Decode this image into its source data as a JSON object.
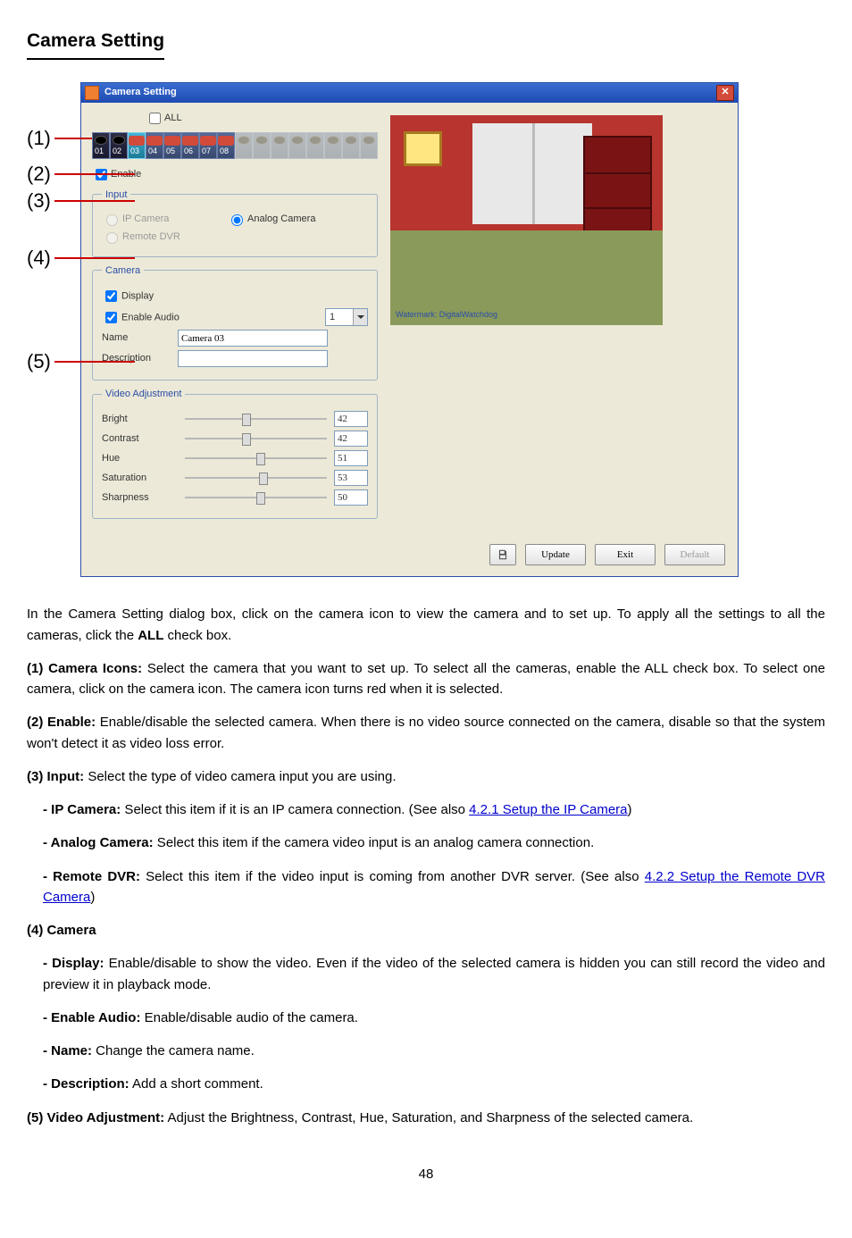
{
  "section_heading": "Camera Setting",
  "callouts": [
    "(1)",
    "(2)",
    "(3)",
    "(4)",
    "(5)"
  ],
  "window": {
    "title": "Camera Setting",
    "all_checkbox": "ALL",
    "tabs": [
      "01",
      "02",
      "03",
      "04",
      "05",
      "06",
      "07",
      "08"
    ],
    "enable": "Enable",
    "input_group": {
      "legend": "Input",
      "ip_camera": "IP Camera",
      "analog_camera": "Analog Camera",
      "remote_dvr": "Remote DVR"
    },
    "camera_group": {
      "legend": "Camera",
      "display": "Display",
      "enable_audio": "Enable Audio",
      "audio_value": "1",
      "name_label": "Name",
      "name_value": "Camera 03",
      "description_label": "Description",
      "description_value": ""
    },
    "video_group": {
      "legend": "Video Adjustment",
      "rows": [
        {
          "label": "Bright",
          "value": "42",
          "pos": 40
        },
        {
          "label": "Contrast",
          "value": "42",
          "pos": 40
        },
        {
          "label": "Hue",
          "value": "51",
          "pos": 50
        },
        {
          "label": "Saturation",
          "value": "53",
          "pos": 52
        },
        {
          "label": "Sharpness",
          "value": "50",
          "pos": 50
        }
      ]
    },
    "preview_watermark": "Watermark: DigitalWatchdog",
    "buttons": {
      "update": "Update",
      "exit": "Exit",
      "default": "Default"
    }
  },
  "text": {
    "p1a": "In the Camera Setting dialog box, click on the camera icon to view the camera and to set up. To apply all the settings to all the cameras, click the ",
    "p1_all": "ALL",
    "p1b": " check box.",
    "item1_t": "(1) Camera Icons:",
    "item1_b": " Select the camera that you want to set up. To select all the cameras, enable the ALL check box. To select one camera, click on the camera icon. The camera icon turns red when it is selected.",
    "item2_t": "(2) Enable:",
    "item2_b": " Enable/disable the selected camera. When there is no video source connected on the camera, disable so that the system won't detect it as video loss erro",
    "item2_c": "r.",
    "item3_t": "(3) Input:",
    "item3_b": " Select the type of video camera input you are using.",
    "sub_ip_t": "- IP Camera:",
    "sub_ip_b": " Select this item if it is an IP camera connection. (See also ",
    "sub_ip_link": "4.2.1 Setup the IP Camera",
    "sub_ip_c": ")",
    "sub_an_t": "- Analog Camera:",
    "sub_an_b": " Select this item if the camera video input is an analog camera connection.",
    "sub_rd_t": "- Remote DVR:",
    "sub_rd_b": " Select this item if the video input is coming from another DVR server. (See also ",
    "sub_rd_link": "4.2.2 Setup the Remote DVR Camera",
    "sub_rd_c": ")",
    "item4_t": "(4) Camera",
    "sub_disp_t": "- Display:",
    "sub_disp_b": " Enable/disable to show the video. Even if the video of the selected camera is hidden you can still record the video and preview it in playback mode.",
    "sub_aud_t": "- Enable Audio:",
    "sub_aud_b": " Enable/disable audio of the camera.",
    "sub_name_t": "- Name:",
    "sub_name_b": " Change the camera name.",
    "sub_desc_t": "- Description:",
    "sub_desc_b": " Add a short comment.",
    "item5_t": "(5) Video Adjustment:",
    "item5_b": " Adjust the Brightness, Contrast, Hue, Saturation, and Sharpness of the selected camera.",
    "page_number": "48"
  }
}
